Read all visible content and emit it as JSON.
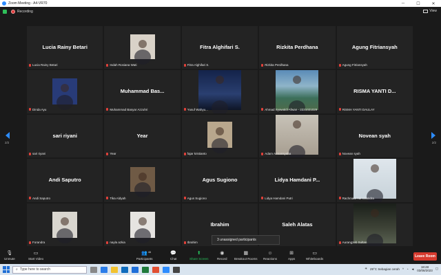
{
  "window": {
    "title": "Zoom Meeting - A4-VR70"
  },
  "recording": {
    "label": "Recording"
  },
  "view": {
    "label": "View"
  },
  "pager": {
    "left": "2/2",
    "right": "2/2"
  },
  "tiles": [
    {
      "big": "Lucia Rainy Betari",
      "name": "Lucia Rainy Betari",
      "photo": ""
    },
    {
      "big": "",
      "name": "Indah Rosiana Wati",
      "photo": "hijab"
    },
    {
      "big": "Fitra Alghifari S.",
      "name": "Fitra Alghifari S.",
      "photo": ""
    },
    {
      "big": "Rizkita Perdhana",
      "name": "Rizkita Perdhana",
      "photo": ""
    },
    {
      "big": "Agung Fitriansyah",
      "name": "Agung Fitriansyah",
      "photo": ""
    },
    {
      "big": "",
      "name": "Dinda Ayu",
      "photo": "girl"
    },
    {
      "big": "Muhammad  Bas...",
      "name": "Muhammad Basyar Azzuhri",
      "photo": ""
    },
    {
      "big": "",
      "name": "Yusuf Wahyu...",
      "photo": "city"
    },
    {
      "big": "",
      "name": "Ahmad Syawaldi Afwan - 2221021029",
      "photo": "sea"
    },
    {
      "big": "RISMA  YANTI  D...",
      "name": "RISMA YANTI DAULAY",
      "photo": ""
    },
    {
      "big": "sari riyani",
      "name": "sari riyani",
      "photo": ""
    },
    {
      "big": "Year",
      "name": "Year",
      "photo": ""
    },
    {
      "big": "",
      "name": "fajar kristianto",
      "photo": "suit"
    },
    {
      "big": "",
      "name": "Adam Armansyaha",
      "photo": "man"
    },
    {
      "big": "Novean syah",
      "name": "Novean syah",
      "photo": ""
    },
    {
      "big": "Andi Saputro",
      "name": "Andi Saputro",
      "photo": ""
    },
    {
      "big": "",
      "name": "Tika Aldyah",
      "photo": "cake"
    },
    {
      "big": "Agus Sugiono",
      "name": "Agus Sugiono",
      "photo": ""
    },
    {
      "big": "Lidya Hamdani P...",
      "name": "Lidya Hamdani Putri",
      "photo": ""
    },
    {
      "big": "",
      "name": "Rachmadi Adi Chandra",
      "photo": "smile"
    },
    {
      "big": "",
      "name": "Forandra",
      "photo": "stand"
    },
    {
      "big": "",
      "name": "nayla azkia",
      "photo": "duo"
    },
    {
      "big": "Ibrahim",
      "name": "Ibrahim",
      "photo": ""
    },
    {
      "big": "Saleh Alatas",
      "name": "...tas",
      "photo": ""
    },
    {
      "big": "",
      "name": "Aurangzeb Sultan",
      "photo": "upper"
    }
  ],
  "popup": {
    "unassigned": "3 unassigned participants"
  },
  "toolbar": {
    "unmute": "Unmute",
    "start_video": "Start Video",
    "participants": "Participants",
    "participants_count": "46",
    "chat": "Chat",
    "share_screen": "Share Screen",
    "record": "Record",
    "breakout": "Breakout Rooms",
    "reactions": "Reactions",
    "apps": "Apps",
    "whiteboards": "Whiteboards",
    "leave": "Leave Room"
  },
  "taskbar": {
    "search_placeholder": "Type here to search",
    "weather": "29°C  Sebagian cerah",
    "time": "18:48",
    "date": "03/08/2023"
  },
  "colors": {
    "accent": "#2d8cff",
    "share_green": "#27c25c",
    "leave_red": "#d63a2e",
    "tile_bg": "#232323"
  }
}
